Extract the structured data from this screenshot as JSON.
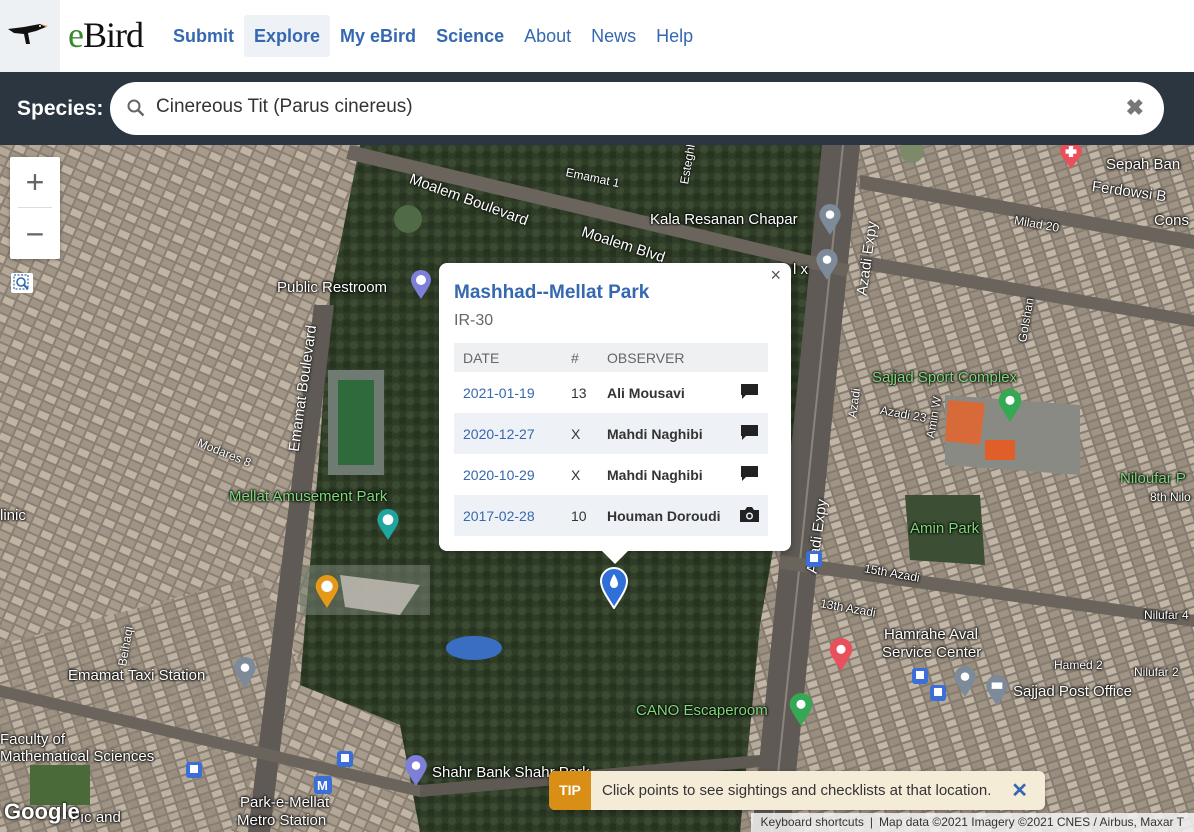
{
  "header": {
    "brand_e": "e",
    "brand_bird": "Bird",
    "nav": [
      {
        "label": "Submit",
        "bold": true,
        "active": false
      },
      {
        "label": "Explore",
        "bold": true,
        "active": true
      },
      {
        "label": "My eBird",
        "bold": true,
        "active": false
      },
      {
        "label": "Science",
        "bold": true,
        "active": false
      },
      {
        "label": "About",
        "bold": false,
        "active": false
      },
      {
        "label": "News",
        "bold": false,
        "active": false
      },
      {
        "label": "Help",
        "bold": false,
        "active": false
      }
    ]
  },
  "species": {
    "label": "Species:",
    "value": "Cinereous Tit (Parus cinereus)",
    "clear_icon": "close-icon"
  },
  "map": {
    "zoom_in": "+",
    "zoom_out": "−",
    "places": {
      "public_restroom": "Public Restroom",
      "mellat_amusement_park": "Mellat Amusement Park",
      "emamat_taxi": "Emamat Taxi Station",
      "kala_resanan": "Kala Resanan Chapar",
      "sajjad_sport": "Sajjad Sport Complex",
      "amin_park": "Amin Park",
      "hamrahe_aval": "Hamrahe Aval",
      "service_center": "Service Center",
      "sajjad_post": "Sajjad Post Office",
      "cano": "CANO Escaperoom",
      "shahr_bank": "Shahr Bank Shahr Park",
      "park_e_mellat": "Park-e-Mellat",
      "metro_station": "Metro Station",
      "faculty": "Faculty of",
      "math_sciences": "Mathematical Sciences",
      "niloufar": "Niloufar P",
      "eighth_nilo": "8th Nilo",
      "sepah_bank": "Sepah Ban",
      "ferdowsi": "Ferdowsi B",
      "cons": "Cons",
      "clinic": "linic",
      "milad": "Milad 20",
      "nilufar_4": "Nilufar 4",
      "nilufar_2": "Nilufar 2",
      "hamed_2": "Hamed 2",
      "fifteenth_azadi": "15th Azadi",
      "thirteenth_azadi": "13th Azadi",
      "azadi_23": "Azadi 23",
      "amin_w": "Amin W",
      "golshan": "Golshan",
      "lx": "l x",
      "pidc": "Pıc and"
    },
    "roads": {
      "moalem_blvd": "Moalem Boulevard",
      "moalem_blvd2": "Moalem Blvd",
      "emamat_blvd": "Emamat Boulevard",
      "azadi_expy": "Azadi Expy",
      "azadi_expy2": "Azadi Expy",
      "azadi": "Azadi",
      "emamat_1": "Emamat 1",
      "modares_8": "Modares 8",
      "beihaqi": "Beihaqi",
      "estegh": "Esteghl"
    }
  },
  "popup": {
    "location": "Mashhad--Mellat Park",
    "region": "IR-30",
    "columns": [
      "DATE",
      "#",
      "OBSERVER"
    ],
    "rows": [
      {
        "date": "2021-01-19",
        "count": "13",
        "observer": "Ali Mousavi",
        "media": "comment-icon"
      },
      {
        "date": "2020-12-27",
        "count": "X",
        "observer": "Mahdi Naghibi",
        "media": "comment-icon"
      },
      {
        "date": "2020-10-29",
        "count": "X",
        "observer": "Mahdi Naghibi",
        "media": "comment-icon"
      },
      {
        "date": "2017-02-28",
        "count": "10",
        "observer": "Houman Doroudi",
        "media": "camera-icon"
      }
    ],
    "close": "×"
  },
  "tip": {
    "tag": "TIP",
    "text": "Click points to see sightings and checklists at that location.",
    "close": "✕"
  },
  "attribution": {
    "google": "Google",
    "keyboard": "Keyboard shortcuts",
    "map_data": "Map data ©2021 Imagery ©2021 CNES / Airbus, Maxar T"
  },
  "colors": {
    "link_blue": "#3568b0",
    "tip_orange": "#d98f16",
    "dark_bar": "#2b3640"
  }
}
